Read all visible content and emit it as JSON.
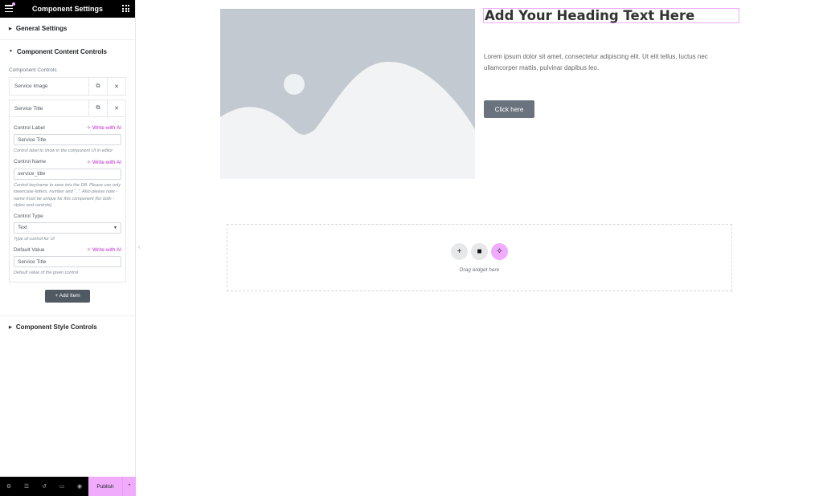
{
  "panel": {
    "title": "Component Settings",
    "sections": {
      "general": "General Settings",
      "content": "Component Content Controls",
      "style": "Component Style Controls"
    },
    "controls_label": "Component Controls",
    "items": [
      {
        "label": "Service Image"
      },
      {
        "label": "Service Title"
      }
    ],
    "ai_label": "Write with AI",
    "fields": {
      "control_label": {
        "label": "Control Label",
        "value": "Service Title",
        "help": "Control label to show in the component UI in editor"
      },
      "control_name": {
        "label": "Control Name",
        "value": "service_title",
        "help": "Control key/name to save into the DB. Please use only lowercase letters, number and \"_\". Also please note - name must be unique for this component (for both - styles and controls)"
      },
      "control_type": {
        "label": "Control Type",
        "value": "Text",
        "help": "Type of control for UI"
      },
      "default_value": {
        "label": "Default Value",
        "value": "Service Title",
        "help": "Default value of the given control"
      }
    },
    "add_item": "Add Item",
    "footer": {
      "publish": "Publish"
    }
  },
  "canvas": {
    "heading": "Add Your Heading Text Here",
    "paragraph": "Lorem ipsum dolor sit amet, consectetur adipiscing elit. Ut elit tellus, luctus nec ullamcorper mattis, pulvinar dapibus leo.",
    "button": "Click here",
    "drop_hint": "Drag widget here"
  },
  "colors": {
    "accent": "#f0abfc",
    "ai_text": "#c026d3",
    "button_bg": "#69727d"
  }
}
